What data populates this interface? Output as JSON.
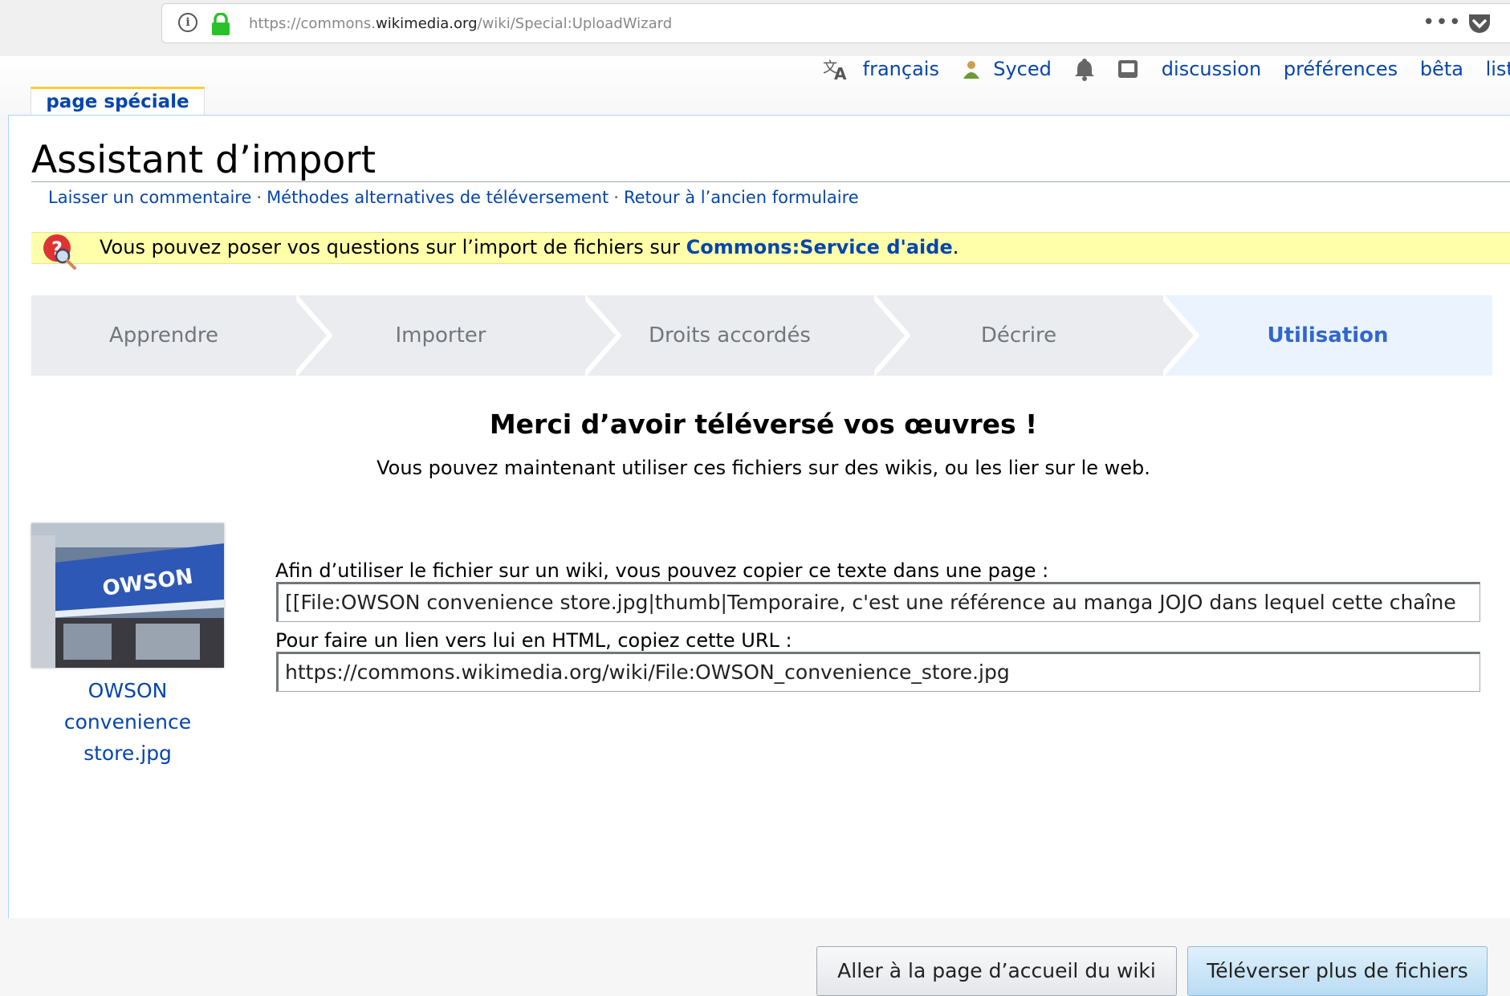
{
  "browser": {
    "url_prefix": "https://commons.",
    "url_domain": "wikimedia.org",
    "url_path": "/wiki/Special:UploadWizard",
    "menu_dots": "•••"
  },
  "personal": {
    "language": "français",
    "user": "Syced",
    "links": [
      "discussion",
      "préférences",
      "bêta",
      "liste"
    ]
  },
  "tab": {
    "label": "page spéciale"
  },
  "page": {
    "title": "Assistant d’import",
    "sublinks": [
      "Laisser un commentaire",
      "Méthodes alternatives de téléversement",
      "Retour à l’ancien formulaire"
    ],
    "separator": "·"
  },
  "notice": {
    "text": "Vous pouvez poser vos questions sur l’import de fichiers sur ",
    "link": "Commons:Service d'aide",
    "end": "."
  },
  "steps": [
    "Apprendre",
    "Importer",
    "Droits accordés",
    "Décrire",
    "Utilisation"
  ],
  "thanks": {
    "heading": "Merci d’avoir téléversé vos œuvres !",
    "subtitle": "Vous pouvez maintenant utiliser ces fichiers sur des wikis, ou les lier sur le web."
  },
  "file": {
    "caption": "OWSON convenience store.jpg",
    "thumb_sign": "OWSON",
    "wikitext_label": "Afin d’utiliser le fichier sur un wiki, vous pouvez copier ce texte dans une page :",
    "wikitext_value": "[[File:OWSON convenience store.jpg|thumb|Temporaire, c'est une référence au manga JOJO dans lequel cette chaîne",
    "url_label": "Pour faire un lien vers lui en HTML, copiez cette URL :",
    "url_value": "https://commons.wikimedia.org/wiki/File:OWSON_convenience_store.jpg"
  },
  "buttons": {
    "home": "Aller à la page d’accueil du wiki",
    "more": "Téléverser plus de fichiers"
  },
  "colors": {
    "link": "#0645ad",
    "active_step": "#3366cc",
    "notice_bg": "#ffffaa",
    "lock": "#2ac12a"
  }
}
